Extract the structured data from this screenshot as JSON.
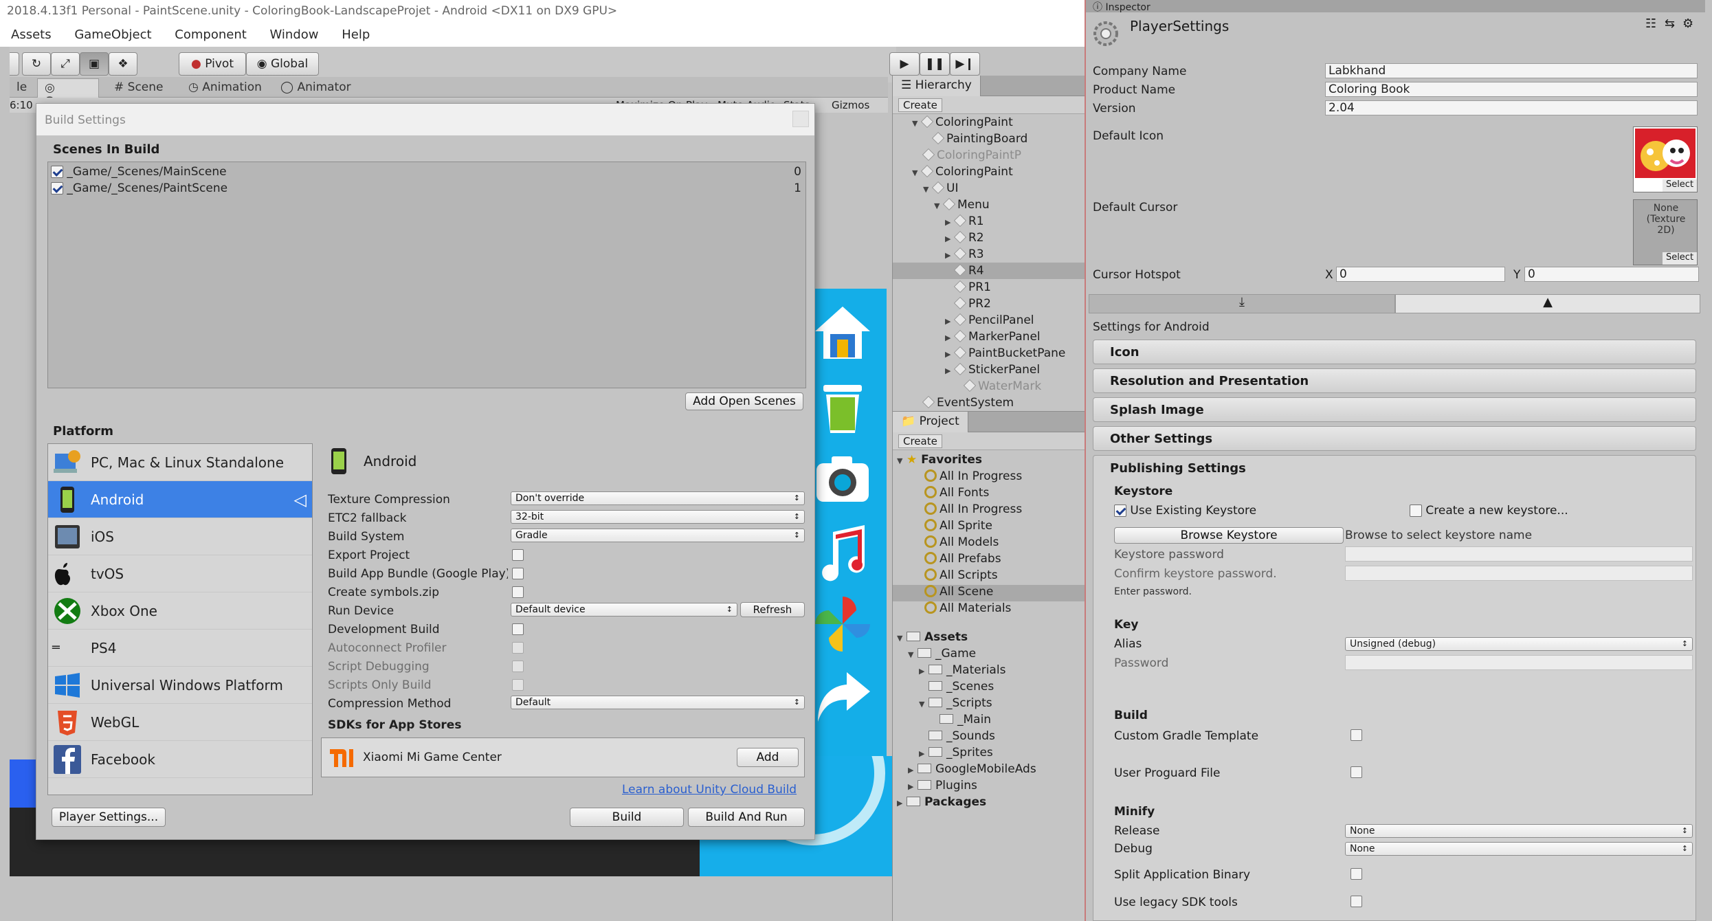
{
  "window": {
    "title": "2018.4.13f1 Personal - PaintScene.unity - ColoringBook-LandscapeProjet - Android <DX11 on DX9 GPU>"
  },
  "menu": [
    "Assets",
    "GameObject",
    "Component",
    "Window",
    "Help"
  ],
  "toolbar": {
    "pivot_label": "Pivot",
    "global_label": "Global"
  },
  "tabs": {
    "le": "le",
    "game": "Game",
    "scene": "Scene",
    "animation": "Animation",
    "animator": "Animator"
  },
  "gamebar": {
    "aspect": "6:10",
    "maximize": "Maximize On Play",
    "mute": "Mute Audio",
    "stats": "Stats",
    "gizmos": "Gizmos"
  },
  "build": {
    "title": "Build Settings",
    "scenes_header": "Scenes In Build",
    "scenes": [
      {
        "path": "_Game/_Scenes/MainScene",
        "index": "0"
      },
      {
        "path": "_Game/_Scenes/PaintScene",
        "index": "1"
      }
    ],
    "add_open_scenes": "Add Open Scenes",
    "platform_header": "Platform",
    "platforms": [
      "PC, Mac & Linux Standalone",
      "Android",
      "iOS",
      "tvOS",
      "Xbox One",
      "PS4",
      "Universal Windows Platform",
      "WebGL",
      "Facebook"
    ],
    "selected_platform": "Android",
    "settings": {
      "texture_compression_label": "Texture Compression",
      "texture_compression_value": "Don't override",
      "etc2_label": "ETC2 fallback",
      "etc2_value": "32-bit",
      "build_system_label": "Build System",
      "build_system_value": "Gradle",
      "export_project": "Export Project",
      "app_bundle": "Build App Bundle (Google Play)",
      "symbols": "Create symbols.zip",
      "run_device_label": "Run Device",
      "run_device_value": "Default device",
      "refresh": "Refresh",
      "dev_build": "Development Build",
      "autoconnect": "Autoconnect Profiler",
      "script_debugging": "Script Debugging",
      "scripts_only": "Scripts Only Build",
      "compression_label": "Compression Method",
      "compression_value": "Default",
      "sdks_header": "SDKs for App Stores",
      "xiaomi": "Xiaomi Mi Game Center",
      "add": "Add"
    },
    "cloud_link": "Learn about Unity Cloud Build",
    "player_settings": "Player Settings...",
    "build": "Build",
    "build_and_run": "Build And Run"
  },
  "hierarchy": {
    "tab": "Hierarchy",
    "create": "Create",
    "items": [
      "ColoringPaint",
      "PaintingBoard",
      "ColoringPaintP",
      "ColoringPaint",
      "UI",
      "Menu",
      "R1",
      "R2",
      "R3",
      "R4",
      "PR1",
      "PR2",
      "PencilPanel",
      "MarkerPanel",
      "PaintBucketPane",
      "StickerPanel",
      "WaterMark",
      "EventSystem"
    ]
  },
  "project": {
    "tab": "Project",
    "create": "Create",
    "favorites_label": "Favorites",
    "favorites": [
      "All In Progress",
      "All Fonts",
      "All In Progress",
      "All Sprite",
      "All Models",
      "All Prefabs",
      "All Scripts",
      "All Scene",
      "All Materials"
    ],
    "assets_label": "Assets",
    "assets": [
      "_Game",
      "_Materials",
      "_Scenes",
      "_Scripts",
      "_Main",
      "_Sounds",
      "_Sprites",
      "GoogleMobileAds",
      "Plugins"
    ],
    "packages_label": "Packages"
  },
  "inspector": {
    "tab": "Inspector",
    "title": "PlayerSettings",
    "company_label": "Company Name",
    "company_value": "Labkhand",
    "product_label": "Product Name",
    "product_value": "Coloring Book",
    "version_label": "Version",
    "version_value": "2.04",
    "default_icon": "Default Icon",
    "default_cursor": "Default Cursor",
    "cursor_none": "None (Texture 2D)",
    "select": "Select",
    "hotspot_label": "Cursor Hotspot",
    "hotspot_x_label": "X",
    "hotspot_x": "0",
    "hotspot_y_label": "Y",
    "hotspot_y": "0",
    "settings_for": "Settings for Android",
    "sections": [
      "Icon",
      "Resolution and Presentation",
      "Splash Image",
      "Other Settings"
    ],
    "publishing": "Publishing Settings",
    "keystore_header": "Keystore",
    "use_existing": "Use Existing Keystore",
    "create_new": "Create a new keystore...",
    "browse_keystore": "Browse Keystore",
    "browse_hint": "Browse to select keystore name",
    "keystore_password": "Keystore password",
    "confirm_password": "Confirm keystore password.",
    "enter_password": "Enter password.",
    "key_header": "Key",
    "alias_label": "Alias",
    "alias_value": "Unsigned (debug)",
    "password_label": "Password",
    "build_header": "Build",
    "custom_gradle": "Custom Gradle Template",
    "user_proguard": "User Proguard File",
    "minify_header": "Minify",
    "release_label": "Release",
    "release_value": "None",
    "debug_label": "Debug",
    "debug_value": "None",
    "split_binary": "Split Application Binary",
    "legacy_sdk": "Use legacy SDK tools"
  }
}
